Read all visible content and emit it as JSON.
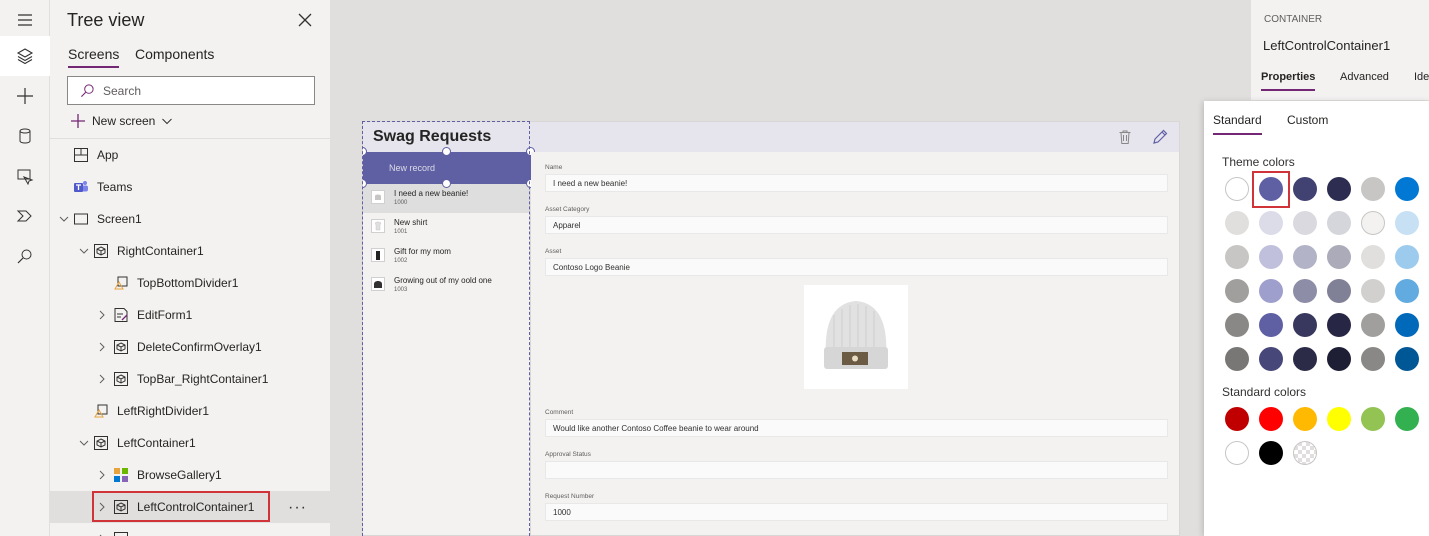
{
  "rail": {
    "icons": [
      "hamburger-icon",
      "layers-icon",
      "plus-icon",
      "database-icon",
      "media-icon",
      "power-automate-icon",
      "search-icon"
    ]
  },
  "tree": {
    "title": "Tree view",
    "tabs": [
      "Screens",
      "Components"
    ],
    "search_placeholder": "Search",
    "new_screen_label": "New screen",
    "nodes": [
      {
        "label": "App"
      },
      {
        "label": "Teams"
      },
      {
        "label": "Screen1"
      },
      {
        "label": "RightContainer1"
      },
      {
        "label": "TopBottomDivider1"
      },
      {
        "label": "EditForm1"
      },
      {
        "label": "DeleteConfirmOverlay1"
      },
      {
        "label": "TopBar_RightContainer1"
      },
      {
        "label": "LeftRightDivider1"
      },
      {
        "label": "LeftContainer1"
      },
      {
        "label": "BrowseGallery1"
      },
      {
        "label": "LeftControlContainer1"
      }
    ],
    "more_label": "···"
  },
  "app": {
    "title": "Swag Requests",
    "new_record_label": "New record",
    "records": [
      {
        "title": "I need a new beanie!",
        "number": "1000"
      },
      {
        "title": "New shirt",
        "number": "1001"
      },
      {
        "title": "Gift for my mom",
        "number": "1002"
      },
      {
        "title": "Growing out of my oold one",
        "number": "1003"
      }
    ],
    "form": {
      "name_label": "Name",
      "name_value": "I need a new beanie!",
      "category_label": "Asset Category",
      "category_value": "Apparel",
      "asset_label": "Asset",
      "asset_value": "Contoso Logo Beanie",
      "comment_label": "Comment",
      "comment_value": "Would like another Contoso Coffee beanie to wear around",
      "approval_label": "Approval Status",
      "approval_value": "",
      "request_label": "Request Number",
      "request_value": "1000"
    }
  },
  "props": {
    "kind": "CONTAINER",
    "name": "LeftControlContainer1",
    "tabs": [
      "Properties",
      "Advanced",
      "Ide"
    ]
  },
  "picker": {
    "tabs": [
      "Standard",
      "Custom"
    ],
    "theme_heading": "Theme colors",
    "standard_heading": "Standard colors",
    "theme_rows": [
      [
        "#ffffff",
        "#5f5fa4",
        "#414172",
        "#2d2d52",
        "#c8c6c4",
        "#0078d4"
      ],
      [
        "#e1dfdd",
        "#dcdce8",
        "#d9d9df",
        "#d5d5dc",
        "#f3f2f1",
        "#c7e0f4"
      ],
      [
        "#c8c6c4",
        "#c0c0dd",
        "#b3b3c7",
        "#ababb9",
        "#e1dfdd",
        "#9ccbed"
      ],
      [
        "#a19f9d",
        "#9f9fcd",
        "#8d8da7",
        "#808096",
        "#d2d0ce",
        "#62abe0"
      ],
      [
        "#8a8886",
        "#5f5fa4",
        "#38385e",
        "#272745",
        "#a19f9d",
        "#0069b9"
      ],
      [
        "#797775",
        "#474779",
        "#2b2b48",
        "#1e1e34",
        "#8a8886",
        "#005796"
      ]
    ],
    "standard_rows": [
      [
        "#c00000",
        "#ff0000",
        "#ffb900",
        "#ffff00",
        "#92c353",
        "#33b04f"
      ],
      [
        "#ffffff",
        "#000000",
        "transparent"
      ]
    ]
  },
  "colors": {
    "accent": "#742774",
    "highlight": "#d13438",
    "selection": "#5f5fa4"
  }
}
